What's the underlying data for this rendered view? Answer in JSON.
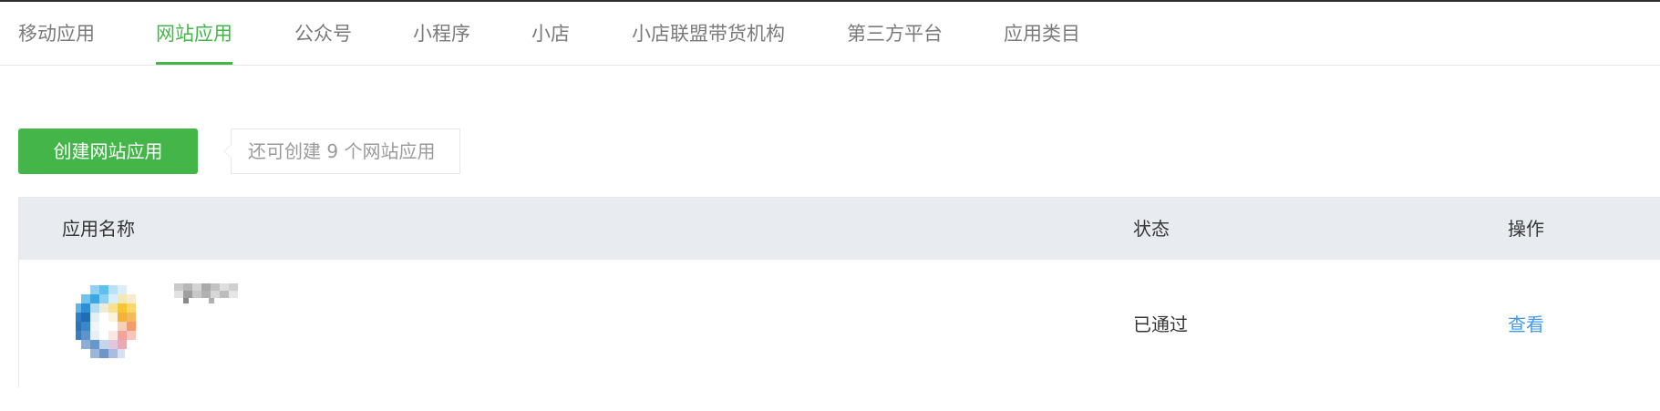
{
  "tabs": [
    {
      "label": "移动应用",
      "active": false
    },
    {
      "label": "网站应用",
      "active": true
    },
    {
      "label": "公众号",
      "active": false
    },
    {
      "label": "小程序",
      "active": false
    },
    {
      "label": "小店",
      "active": false
    },
    {
      "label": "小店联盟带货机构",
      "active": false
    },
    {
      "label": "第三方平台",
      "active": false
    },
    {
      "label": "应用类目",
      "active": false
    }
  ],
  "toolbar": {
    "create_label": "创建网站应用",
    "quota_tip": "还可创建 9 个网站应用"
  },
  "table": {
    "headers": {
      "name": "应用名称",
      "status": "状态",
      "action": "操作"
    },
    "rows": [
      {
        "icon": "app-icon-pixelated",
        "name": "",
        "status": "已通过",
        "action": "查看"
      }
    ]
  },
  "colors": {
    "accent": "#44b549",
    "link": "#459ae9",
    "header_bg": "#e8ecf1",
    "border": "#e7e7eb"
  }
}
